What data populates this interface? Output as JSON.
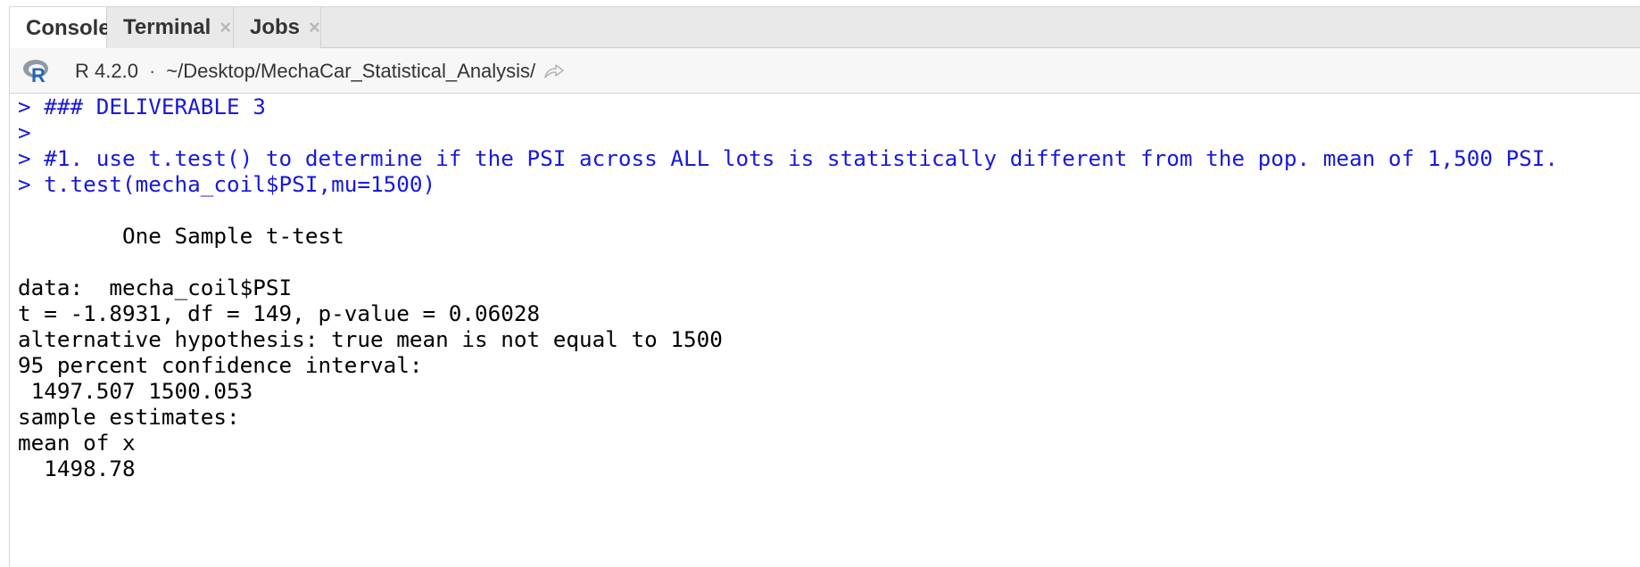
{
  "tabs": [
    {
      "label": "Console",
      "active": true,
      "closable": false
    },
    {
      "label": "Terminal",
      "active": false,
      "closable": true
    },
    {
      "label": "Jobs",
      "active": false,
      "closable": true
    }
  ],
  "toolbar": {
    "r_version": "R 4.2.0",
    "separator": "·",
    "working_dir": "~/Desktop/MechaCar_Statistical_Analysis/"
  },
  "console": {
    "lines": [
      {
        "kind": "input",
        "text": "> ### DELIVERABLE 3"
      },
      {
        "kind": "input",
        "text": ">"
      },
      {
        "kind": "input",
        "text": "> #1. use t.test() to determine if the PSI across ALL lots is statistically different from the pop. mean of 1,500 PSI."
      },
      {
        "kind": "input",
        "text": "> t.test(mecha_coil$PSI,mu=1500)"
      },
      {
        "kind": "output",
        "text": ""
      },
      {
        "kind": "output",
        "text": "        One Sample t-test"
      },
      {
        "kind": "output",
        "text": ""
      },
      {
        "kind": "output",
        "text": "data:  mecha_coil$PSI"
      },
      {
        "kind": "output",
        "text": "t = -1.8931, df = 149, p-value = 0.06028"
      },
      {
        "kind": "output",
        "text": "alternative hypothesis: true mean is not equal to 1500"
      },
      {
        "kind": "output",
        "text": "95 percent confidence interval:"
      },
      {
        "kind": "output",
        "text": " 1497.507 1500.053"
      },
      {
        "kind": "output",
        "text": "sample estimates:"
      },
      {
        "kind": "output",
        "text": "mean of x"
      },
      {
        "kind": "output",
        "text": "  1498.78"
      }
    ]
  },
  "colors": {
    "input_text": "#1818e0",
    "output_text": "#000000",
    "tabbar_bg": "#e9e9e9",
    "toolbar_bg": "#f7f7f7",
    "r_logo_blue": "#2266b8",
    "r_logo_gray": "#8e9aa6"
  },
  "icons": {
    "r_logo": "r-logo-icon",
    "goto_dir": "goto-directory-icon",
    "close_tab": "close-icon"
  }
}
